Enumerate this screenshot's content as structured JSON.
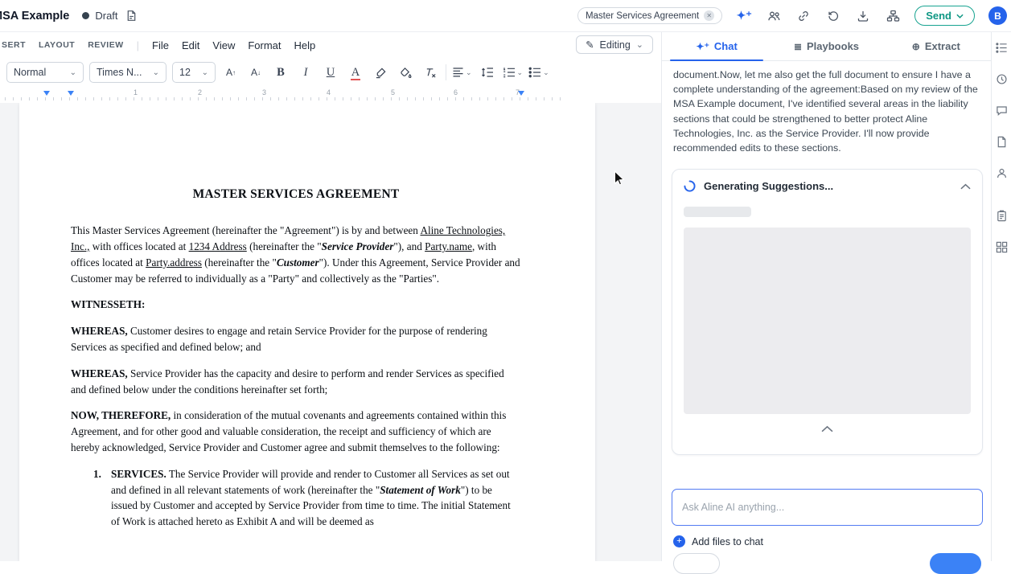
{
  "top_bar": {
    "title": "MSA Example",
    "status": "Draft",
    "doc_pill": "Master Services Agreement",
    "send_label": "Send",
    "avatar_initial": "B"
  },
  "menu_bar": {
    "ribbon": [
      "SERT",
      "LAYOUT",
      "REVIEW"
    ],
    "menus": [
      "File",
      "Edit",
      "View",
      "Format",
      "Help"
    ],
    "mode_label": "Editing"
  },
  "toolbar": {
    "style": "Normal",
    "font": "Times N...",
    "size": "12",
    "size_up": "A",
    "size_down": "A",
    "bold": "B",
    "italic": "I",
    "underline": "U",
    "text_color": "A",
    "clear": "Tx"
  },
  "ruler": {
    "numbers": [
      "1",
      "2",
      "3",
      "4",
      "5",
      "6",
      "7"
    ]
  },
  "document": {
    "title": "MASTER SERVICES AGREEMENT",
    "paragraphs": [
      {
        "runs": [
          {
            "t": "This Master Services Agreement (hereinafter the \"Agreement\") is by and between "
          },
          {
            "t": "Aline Technologies, Inc.,",
            "u": true
          },
          {
            "t": " with offices located at "
          },
          {
            "t": "1234 Address",
            "u": true
          },
          {
            "t": " (hereinafter the \""
          },
          {
            "t": "Service Provider",
            "b": true,
            "i": true
          },
          {
            "t": "\"), and "
          },
          {
            "t": "Party.name",
            "u": true
          },
          {
            "t": ", with offices located at "
          },
          {
            "t": "Party.address",
            "u": true
          },
          {
            "t": " (hereinafter the \""
          },
          {
            "t": "Customer",
            "b": true,
            "i": true
          },
          {
            "t": "\").  Under this Agreement, Service Provider and Customer may be referred to individually as a \"Party\" and collectively as the \"Parties\"."
          }
        ]
      },
      {
        "runs": [
          {
            "t": "WITNESSETH:",
            "b": true
          }
        ]
      },
      {
        "runs": [
          {
            "t": "WHEREAS,",
            "b": true
          },
          {
            "t": " Customer desires to engage and retain Service Provider for the purpose of rendering Services as specified and defined below; and"
          }
        ]
      },
      {
        "runs": [
          {
            "t": "WHEREAS,",
            "b": true
          },
          {
            "t": " Service Provider has the capacity and desire to perform and render Services as specified and defined below under the conditions hereinafter set forth;"
          }
        ]
      },
      {
        "runs": [
          {
            "t": "NOW, THEREFORE,",
            "b": true
          },
          {
            "t": " in consideration of the mutual covenants and agreements contained within this Agreement, and for other good and valuable consideration, the receipt and sufficiency of which are hereby acknowledged, Service Provider and Customer agree and submit themselves to the following:"
          }
        ]
      },
      {
        "list": "1.",
        "runs": [
          {
            "t": "SERVICES.",
            "b": true
          },
          {
            "t": " The Service Provider will provide and render to Customer all Services as set out and defined in all relevant statements of work (hereinafter the \""
          },
          {
            "t": "Statement of Work",
            "b": true,
            "i": true
          },
          {
            "t": "\") to be issued by Customer and accepted by Service Provider from time to time. The initial Statement of Work is attached hereto as Exhibit A and will be deemed as"
          }
        ]
      }
    ]
  },
  "chat": {
    "tabs": [
      {
        "icon": "✦⁺",
        "label": "Chat"
      },
      {
        "icon": "≣",
        "label": "Playbooks"
      },
      {
        "icon": "⊕",
        "label": "Extract"
      }
    ],
    "message": "document.Now, let me also get the full document to ensure I have a complete understanding of the agreement:Based on my review of the MSA Example document, I've identified several areas in the liability sections that could be strengthened to better protect Aline Technologies, Inc. as the Service Provider. I'll now provide recommended edits to these sections.",
    "card_title": "Generating Suggestions...",
    "input_placeholder": "Ask Aline AI anything...",
    "add_files_label": "Add files to chat"
  },
  "icons": {
    "close": "✕",
    "plus": "+",
    "pencil": "✎",
    "chevron_down": "⌄",
    "sparkles": "✦⁺"
  },
  "colors": {
    "accent": "#2563eb",
    "send": "#0f9784",
    "draft_dot": "#35424f"
  }
}
